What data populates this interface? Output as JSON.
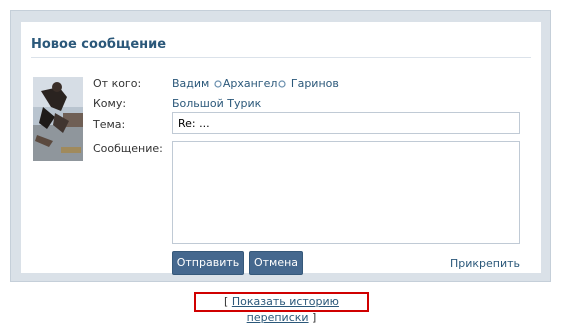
{
  "form": {
    "title": "Новое сообщение",
    "from_label": "От кого:",
    "from_first": "Вадим",
    "from_nick": "Архангел",
    "from_last": "Гаринов",
    "to_label": "Кому:",
    "to_value": "Большой Турик",
    "subject_label": "Тема:",
    "subject_value": "Re: ...",
    "message_label": "Сообщение:",
    "message_value": "",
    "send_button": "Отправить",
    "cancel_button": "Отмена",
    "attach_link": "Прикрепить"
  },
  "history": {
    "open_bracket": "[",
    "link": "Показать историю переписки",
    "close_bracket": "]"
  },
  "colors": {
    "accent": "#2b587a",
    "button": "#45688e",
    "highlight_border": "#d00000",
    "panel_bg": "#dae1e8"
  }
}
